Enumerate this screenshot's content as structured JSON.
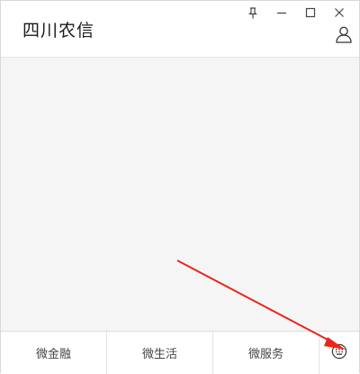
{
  "window": {
    "title": "四川农信"
  },
  "title_controls": {
    "pin_icon": "pin-icon",
    "minimize_icon": "minimize-icon",
    "maximize_icon": "maximize-icon",
    "close_icon": "close-icon"
  },
  "header": {
    "user_icon": "user-icon"
  },
  "bottom_menu": {
    "tabs": [
      {
        "label": "微金融"
      },
      {
        "label": "微生活"
      },
      {
        "label": "微服务"
      }
    ],
    "keyboard_icon": "keyboard-icon"
  },
  "colors": {
    "annotation_arrow": "#e8261c",
    "background": "#f5f5f5",
    "bar": "#ffffff"
  }
}
